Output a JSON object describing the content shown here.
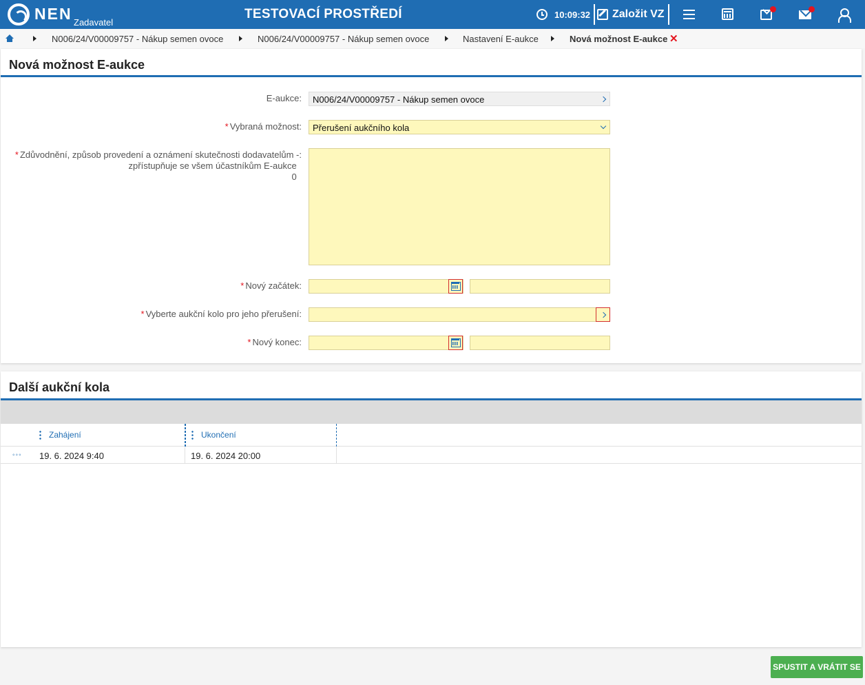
{
  "header": {
    "logo_text": "NEN",
    "logo_sub": "Zadavatel",
    "environment": "TESTOVACÍ PROSTŘEDÍ",
    "time": "10:09:32",
    "create_label": "Založit VZ",
    "colors": {
      "bar": "#1f6db3",
      "notification": "#e4151f"
    }
  },
  "breadcrumb": {
    "items": [
      "N006/24/V00009757 - Nákup semen ovoce",
      "N006/24/V00009757 - Nákup semen ovoce",
      "Nastavení E-aukce",
      "Nová možnost E-aukce"
    ]
  },
  "form": {
    "title": "Nová možnost E-aukce",
    "fields": {
      "eauction": {
        "label": "E-aukce:",
        "value": "N006/24/V00009757 - Nákup semen ovoce"
      },
      "option": {
        "label": "Vybraná možnost:",
        "value": "Přerušení aukčního kola"
      },
      "justification": {
        "label_line1": "Zdůvodnění, způsob provedení a oznámení skutečnosti dodavatelům -:",
        "label_line2": "zpřístupňuje se všem účastníkům E-aukce",
        "counter": "0",
        "value": ""
      },
      "new_start": {
        "label": "Nový začátek:",
        "date": "",
        "time": ""
      },
      "round": {
        "label": "Vyberte aukční kolo pro jeho přerušení:",
        "value": ""
      },
      "new_end": {
        "label": "Nový konec:",
        "date": "",
        "time": ""
      }
    },
    "required_mark": "*"
  },
  "rounds": {
    "title": "Další aukční kola",
    "columns": [
      "Zahájení",
      "Ukončení"
    ],
    "rows": [
      {
        "start": "19. 6. 2024 9:40",
        "end": "19. 6. 2024 20:00"
      }
    ]
  },
  "actions": {
    "submit_label": "SPUSTIT A VRÁTIT SE",
    "submit_color": "#4caf50"
  }
}
